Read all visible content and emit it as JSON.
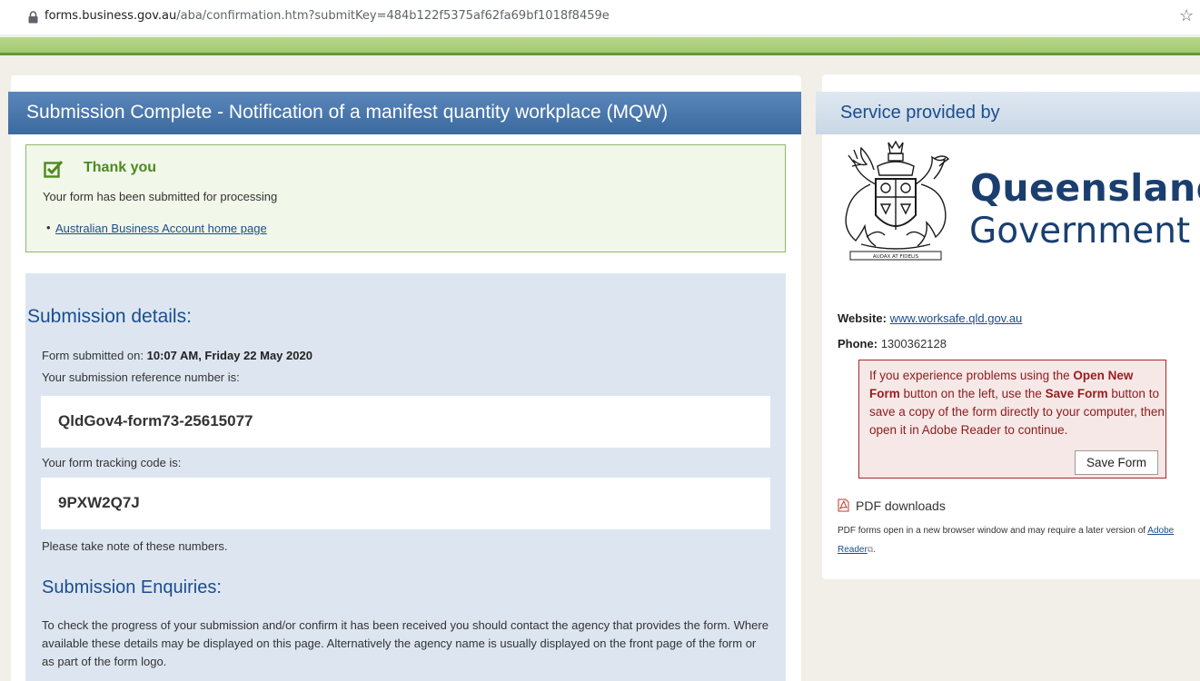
{
  "browser": {
    "url_host": "forms.business.gov.au",
    "url_path": "/aba/confirmation.htm?submitKey=484b122f5375af62fa69bf1018f8459e"
  },
  "main": {
    "title": "Submission Complete - Notification of a manifest quantity workplace (MQW)",
    "thanks": {
      "title": "Thank you",
      "message": "Your form has been submitted for processing",
      "link": "Australian Business Account home page"
    },
    "details": {
      "heading": "Submission details:",
      "submitted_label": "Form submitted on: ",
      "submitted_value": "10:07 AM, Friday 22 May 2020",
      "reference_label": "Your submission reference number is:",
      "reference_value": "QldGov4-form73-25615077",
      "tracking_label": "Your form tracking code is:",
      "tracking_value": "9PXW2Q7J",
      "note": "Please take note of these numbers."
    },
    "enquiries": {
      "heading": "Submission Enquiries:",
      "text": "To check the progress of your submission and/or confirm it has been received you should contact the agency that provides the form. Where available these details may be displayed on this page. Alternatively the agency name is usually displayed on the front page of the form or as part of the form logo."
    }
  },
  "sidebar": {
    "title": "Service provided by",
    "logo_line1": "Queensland",
    "logo_line2": "Government",
    "crest_motto": "AUDAX AT FIDELIS",
    "website_label": "Website:",
    "website_value": "www.worksafe.qld.gov.au",
    "phone_label": "Phone:",
    "phone_value": "1300362128",
    "warning": {
      "t1": "If you experience problems using the ",
      "b1": "Open New Form",
      "t2": " button on the left, use the ",
      "b2": "Save Form",
      "t3": " button to save a copy of the form directly to your computer, then open it in Adobe Reader to continue."
    },
    "save_button": "Save Form",
    "pdf_heading": "PDF downloads",
    "pdf_note": "PDF forms open in a new browser window and may require a later version of ",
    "pdf_link": "Adobe Reader"
  },
  "colors": {
    "header_blue": "#3b6a9f",
    "link_blue": "#1a4d8f",
    "success_green": "#4c8a1f",
    "warning_red": "#a8272a"
  }
}
